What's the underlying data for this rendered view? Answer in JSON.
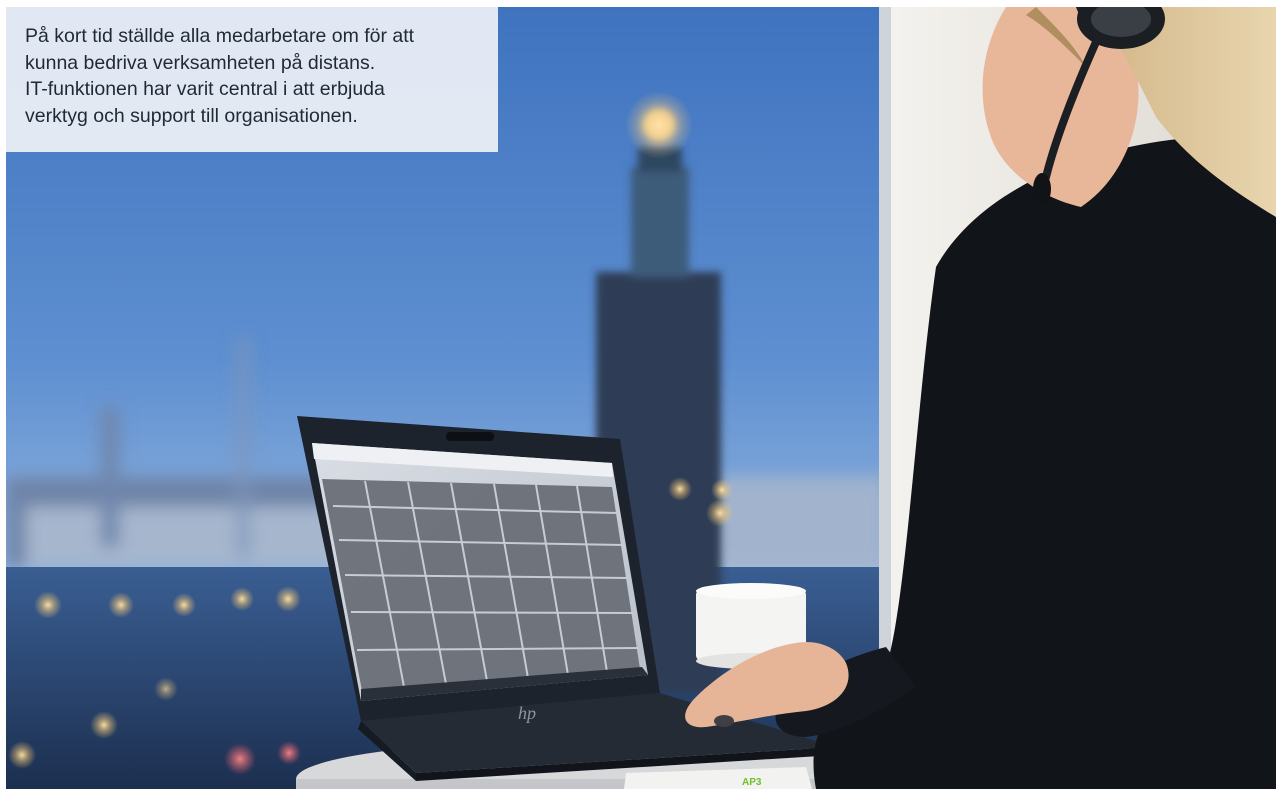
{
  "caption": {
    "lines": [
      "På kort tid ställde alla medarbetare om för att",
      "kunna bedriva verksamheten på distans.",
      "IT-funktionen har varit central i att erbjuda",
      "verktyg och support till organisationen."
    ]
  },
  "photo": {
    "laptop_brand": "hp",
    "tray_label": "AP3",
    "colors": {
      "sky": "#5e8fd1",
      "tower": "#2d3e55",
      "wall": "#eceae4",
      "jacket": "#111418",
      "hair": "#d9bf92",
      "tray_label": "#6fbe2a"
    }
  }
}
